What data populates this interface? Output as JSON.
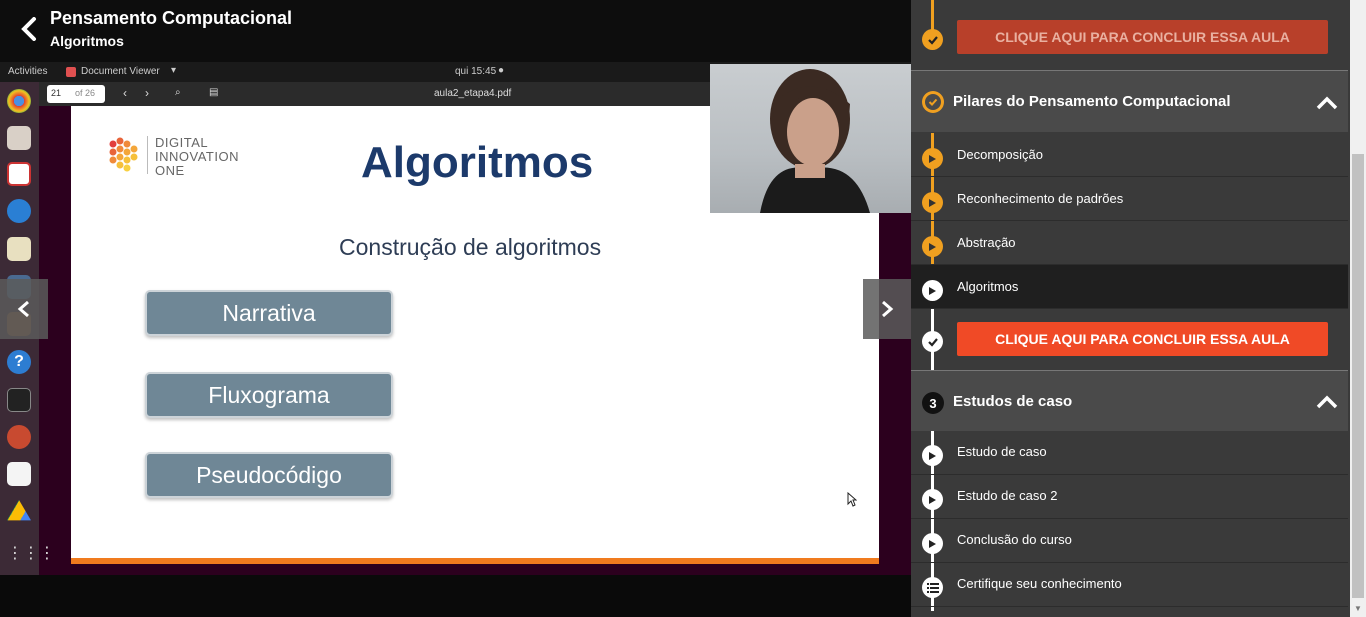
{
  "header": {
    "course_title": "Pensamento Computacional",
    "lesson_subtitle": "Algoritmos"
  },
  "desktop": {
    "activities": "Activities",
    "app_name": "Document Viewer",
    "clock": "qui 15:45",
    "page_current": "21",
    "page_total": "of 26",
    "file_name": "aula2_etapa4.pdf"
  },
  "slide": {
    "logo_line1": "DIGITAL",
    "logo_line2": "INNOVATION",
    "logo_line3": "ONE",
    "title": "Algoritmos",
    "subtitle": "Construção de algoritmos",
    "items": [
      "Narrativa",
      "Fluxograma",
      "Pseudocódigo"
    ]
  },
  "sidebar": {
    "conclude_label": "CLIQUE AQUI PARA CONCLUIR ESSA AULA",
    "section2": {
      "title": "Pilares do Pensamento Computacional",
      "lessons": [
        "Decomposição",
        "Reconhecimento de padrões",
        "Abstração",
        "Algoritmos"
      ]
    },
    "section3": {
      "number": "3",
      "title": "Estudos de caso",
      "lessons": [
        "Estudo de caso",
        "Estudo de caso 2",
        "Conclusão do curso",
        "Certifique seu conhecimento"
      ]
    }
  },
  "colors": {
    "accent_orange": "#f0a020",
    "conclude_red": "#f04a26",
    "slide_title_blue": "#1c3a6b"
  }
}
